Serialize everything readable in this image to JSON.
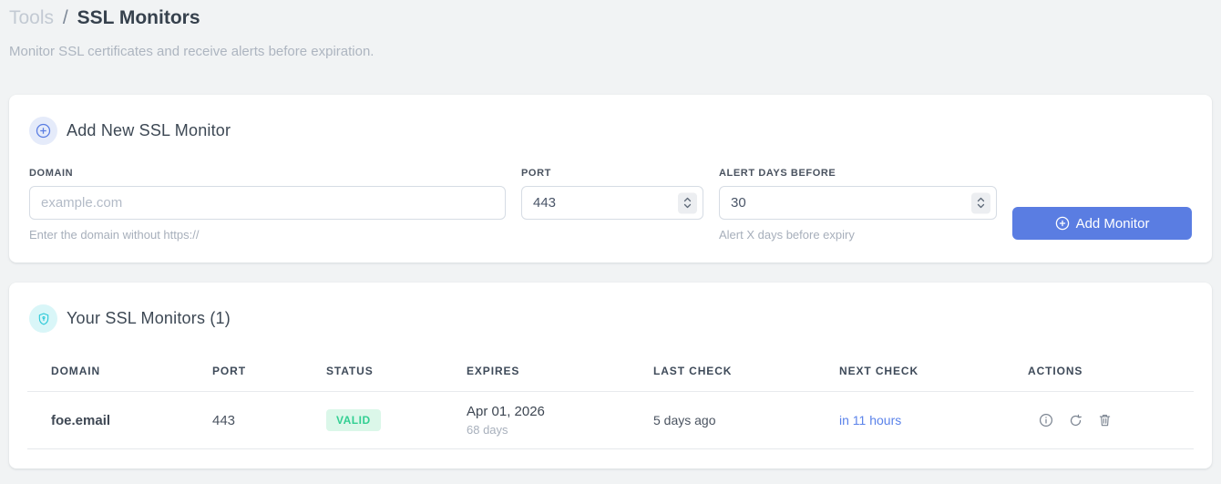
{
  "breadcrumb": {
    "parent": "Tools",
    "separator": "/",
    "current": "SSL Monitors"
  },
  "subtitle": "Monitor SSL certificates and receive alerts before expiration.",
  "add_monitor_card": {
    "title": "Add New SSL Monitor",
    "icon": "plus-circle-icon",
    "fields": {
      "domain": {
        "label": "DOMAIN",
        "placeholder": "example.com",
        "value": "",
        "helper": "Enter the domain without https://"
      },
      "port": {
        "label": "PORT",
        "value": "443"
      },
      "alert_days": {
        "label": "ALERT DAYS BEFORE",
        "value": "30",
        "helper": "Alert X days before expiry"
      }
    },
    "submit_label": "Add Monitor"
  },
  "monitors_card": {
    "title": "Your SSL Monitors (1)",
    "icon": "shield-icon",
    "table": {
      "headers": [
        "DOMAIN",
        "PORT",
        "STATUS",
        "EXPIRES",
        "LAST CHECK",
        "NEXT CHECK",
        "ACTIONS"
      ],
      "rows": [
        {
          "domain": "foe.email",
          "port": "443",
          "status": "VALID",
          "expires_date": "Apr 01, 2026",
          "expires_in": "68 days",
          "last_check": "5 days ago",
          "next_check": "in 11 hours",
          "actions": [
            "info-icon",
            "refresh-icon",
            "trash-icon"
          ]
        }
      ]
    }
  },
  "colors": {
    "accent_blue": "#5a7de2",
    "link_blue": "#5b83ea",
    "success_bg": "#dbf7e9",
    "success_text": "#32cf92",
    "cyan_icon": "#2ec9d8",
    "page_bg": "#f1f3f4"
  }
}
